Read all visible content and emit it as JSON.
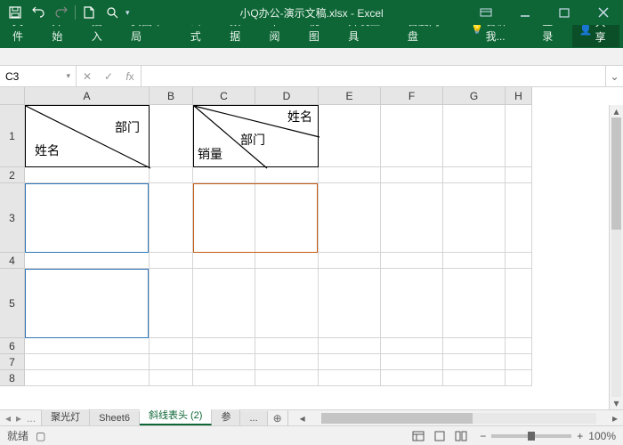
{
  "title": "小Q办公-演示文稿.xlsx - Excel",
  "ribbon": {
    "tabs": [
      "文件",
      "开始",
      "插入",
      "页面布局",
      "公式",
      "数据",
      "审阅",
      "视图",
      "开发工具",
      "百度网盘"
    ],
    "tell": "告诉我...",
    "login": "登录",
    "share": "共享"
  },
  "nameBox": "C3",
  "columns": [
    {
      "l": "A",
      "w": 140
    },
    {
      "l": "B",
      "w": 49
    },
    {
      "l": "C",
      "w": 70
    },
    {
      "l": "D",
      "w": 71
    },
    {
      "l": "E",
      "w": 70
    },
    {
      "l": "F",
      "w": 70
    },
    {
      "l": "G",
      "w": 70
    },
    {
      "l": "H",
      "w": 30
    }
  ],
  "rows": [
    {
      "n": 1,
      "h": 70
    },
    {
      "n": 2,
      "h": 18
    },
    {
      "n": 3,
      "h": 78
    },
    {
      "n": 4,
      "h": 18
    },
    {
      "n": 5,
      "h": 78
    },
    {
      "n": 6,
      "h": 18
    },
    {
      "n": 7,
      "h": 18
    },
    {
      "n": 8,
      "h": 18
    }
  ],
  "a1": {
    "tl": "部门",
    "bl": "姓名"
  },
  "c1": {
    "tr": "姓名",
    "mid": "部门",
    "bl": "销量"
  },
  "sheets": {
    "items": [
      "聚光灯",
      "Sheet6",
      "斜线表头 (2)",
      "参"
    ],
    "active": 2,
    "more": "..."
  },
  "status": {
    "ready": "就绪",
    "zoom": "100%"
  }
}
